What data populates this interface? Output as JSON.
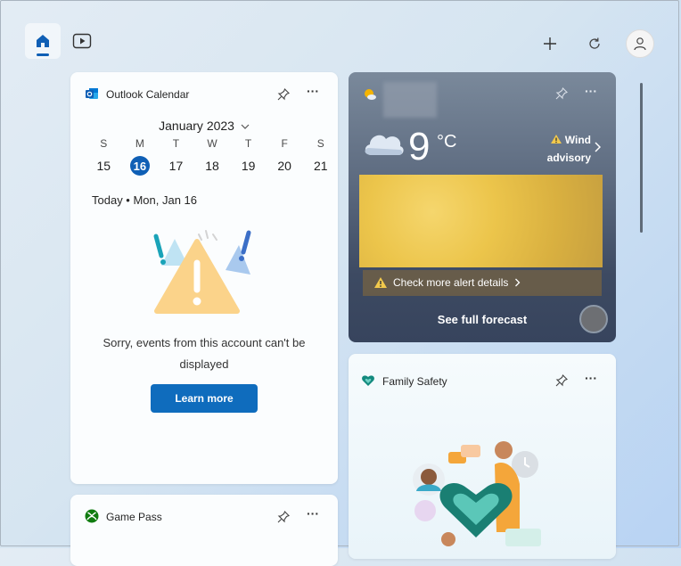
{
  "nav": {
    "home_icon": "home-icon",
    "video_icon": "video-icon"
  },
  "toolbar": {
    "add_icon": "plus-icon",
    "refresh_icon": "refresh-icon",
    "profile_icon": "person-icon"
  },
  "outlook": {
    "title": "Outlook Calendar",
    "month": "January 2023",
    "weekdays": [
      "S",
      "M",
      "T",
      "W",
      "T",
      "F",
      "S"
    ],
    "dates": [
      "15",
      "16",
      "17",
      "18",
      "19",
      "20",
      "21"
    ],
    "today_label": "Today • Mon, Jan 16",
    "error_message": "Sorry, events from this account can't be displayed",
    "learn_more": "Learn more"
  },
  "weather": {
    "temperature": "9",
    "unit": "°C",
    "alert_line1": "Wind",
    "alert_line2": "advisory",
    "alert_link": "Check more alert details",
    "forecast_link": "See full forecast"
  },
  "family": {
    "title": "Family Safety"
  },
  "gamepass": {
    "title": "Game Pass"
  },
  "colors": {
    "accent": "#0f6cbd",
    "today_circle": "#0f5fb5",
    "weather_bg": "#4a586f"
  }
}
